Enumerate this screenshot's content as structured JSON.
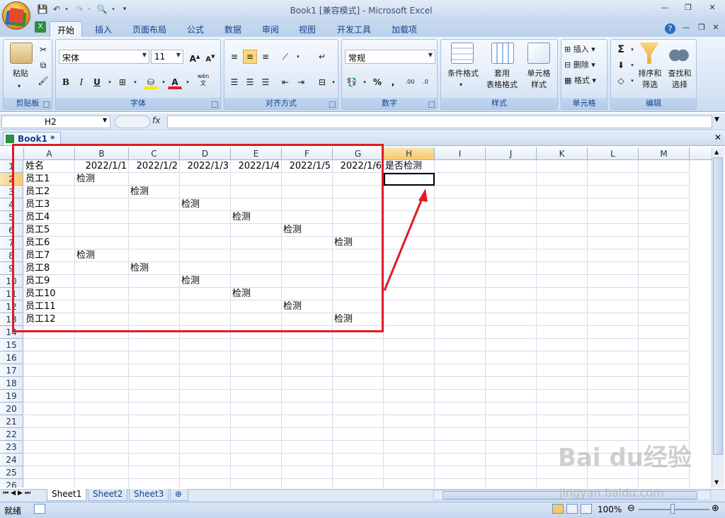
{
  "window": {
    "title": "Book1  [兼容模式] - Microsoft Excel"
  },
  "tabs": [
    "开始",
    "插入",
    "页面布局",
    "公式",
    "数据",
    "审阅",
    "视图",
    "开发工具",
    "加载项"
  ],
  "active_tab": "开始",
  "ribbon": {
    "clipboard": {
      "label": "剪贴板",
      "paste": "粘贴"
    },
    "font": {
      "label": "字体",
      "font_name": "宋体",
      "font_size": "11",
      "bold": "B",
      "italic": "I",
      "underline": "U",
      "phonetic": "wén"
    },
    "alignment": {
      "label": "对齐方式"
    },
    "number": {
      "label": "数字",
      "format": "常规",
      "percent": "%",
      "comma": ","
    },
    "styles": {
      "label": "样式",
      "conditional": "条件格式",
      "table_format_1": "套用",
      "table_format_2": "表格格式",
      "cell_style_1": "单元格",
      "cell_style_2": "样式"
    },
    "cells": {
      "label": "单元格",
      "insert": "插入",
      "delete": "删除",
      "format": "格式"
    },
    "editing": {
      "label": "编辑",
      "sort_1": "排序和",
      "sort_2": "筛选",
      "find_1": "查找和",
      "find_2": "选择",
      "sigma": "Σ"
    }
  },
  "formula_bar": {
    "name_box": "H2",
    "fx": "fx",
    "formula": ""
  },
  "workbook_tab": "Book1 *",
  "columns": [
    "A",
    "B",
    "C",
    "D",
    "E",
    "F",
    "G",
    "H",
    "I",
    "J",
    "K",
    "L",
    "M"
  ],
  "rows": [
    "1",
    "2",
    "3",
    "4",
    "5",
    "6",
    "7",
    "8",
    "9",
    "10",
    "11",
    "12",
    "13",
    "14",
    "15",
    "16",
    "17",
    "18",
    "19",
    "20",
    "21",
    "22",
    "23",
    "24",
    "25",
    "26"
  ],
  "selected_cell": "H2",
  "table": {
    "header": {
      "name": "姓名",
      "dates": [
        "2022/1/1",
        "2022/1/2",
        "2022/1/3",
        "2022/1/4",
        "2022/1/5",
        "2022/1/6"
      ],
      "check": "是否检测"
    },
    "rows": [
      {
        "name": "员工1",
        "col": 1
      },
      {
        "name": "员工2",
        "col": 2
      },
      {
        "name": "员工3",
        "col": 3
      },
      {
        "name": "员工4",
        "col": 4
      },
      {
        "name": "员工5",
        "col": 5
      },
      {
        "name": "员工6",
        "col": 6
      },
      {
        "name": "员工7",
        "col": 1
      },
      {
        "name": "员工8",
        "col": 2
      },
      {
        "name": "员工9",
        "col": 3
      },
      {
        "name": "员工10",
        "col": 4
      },
      {
        "name": "员工11",
        "col": 5
      },
      {
        "name": "员工12",
        "col": 6
      }
    ],
    "mark": "检测"
  },
  "sheets": [
    "Sheet1",
    "Sheet2",
    "Sheet3"
  ],
  "active_sheet": "Sheet1",
  "status": {
    "mode": "就绪",
    "zoom": "100%"
  },
  "watermark": {
    "brand": "Bai du经验",
    "url": "jingyan.baidu.com"
  },
  "colors": {
    "annotation": "#e01b24",
    "ribbon": "#dbe7f6",
    "selected_header": "#f7c96e"
  }
}
